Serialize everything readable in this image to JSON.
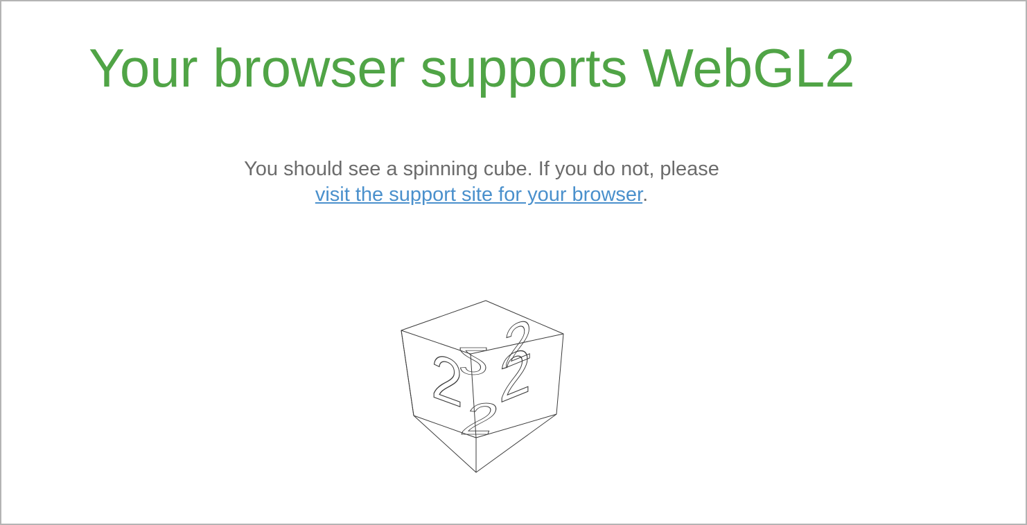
{
  "colors": {
    "headline": "#50a446",
    "body_text": "#6b6b6b",
    "link": "#4a90cc",
    "cube_line": "#3a3a3a",
    "border": "#b4b4b4"
  },
  "headline": "Your browser supports WebGL2",
  "message": {
    "line1": "You should see a spinning cube. If you do not, please",
    "link_text": "visit the support site for your browser",
    "trailing": "."
  },
  "cube": {
    "icon": "spinning-cube-logo",
    "face_glyph": "2"
  }
}
